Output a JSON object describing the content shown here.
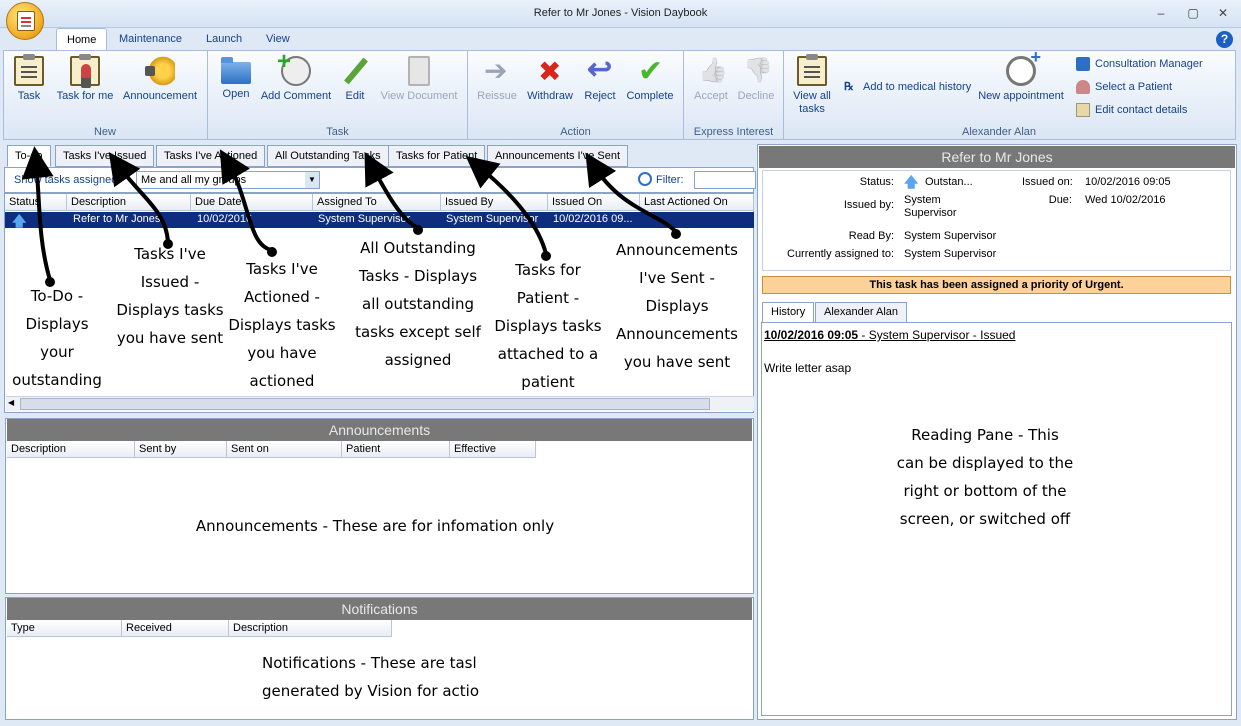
{
  "window": {
    "title": "Refer to Mr Jones - Vision Daybook",
    "controls": [
      "–",
      "▢",
      "✕"
    ]
  },
  "ribbon_tabs": [
    "Home",
    "Maintenance",
    "Launch",
    "View"
  ],
  "ribbon": {
    "new": {
      "title": "New",
      "buttons": [
        "Task",
        "Task for me",
        "Announcement"
      ]
    },
    "task": {
      "title": "Task",
      "buttons": [
        "Open",
        "Add Comment",
        "Edit",
        "View Document"
      ]
    },
    "action": {
      "title": "Action",
      "buttons": [
        "Reissue",
        "Withdraw",
        "Reject",
        "Complete"
      ]
    },
    "express": {
      "title": "Express Interest",
      "buttons": [
        "Accept",
        "Decline"
      ]
    },
    "user": {
      "title": "Alexander Alan",
      "view_all": "View all tasks",
      "add_history": "Add to medical history",
      "new_appointment": "New appointment",
      "consultation_manager": "Consultation Manager",
      "select_patient": "Select a Patient",
      "edit_contact": "Edit contact details"
    }
  },
  "daybook_tabs": [
    "To-do",
    "Tasks I've Issued",
    "Tasks I've Actioned",
    "All Outstanding Tasks",
    "Tasks for Patient",
    "Announcements I've Sent"
  ],
  "filter": {
    "show_label": "Show tasks assigned",
    "show_value": "Me and all my groups",
    "filter_label": "Filter:"
  },
  "task_columns": [
    "Status",
    "Description",
    "Due Date",
    "Assigned To",
    "Issued By",
    "Issued On",
    "Last Actioned On"
  ],
  "task_rows": [
    {
      "description": "Refer to Mr Jones",
      "due": "10/02/2016",
      "assigned": "System Supervisor",
      "issued_by": "System Supervisor",
      "issued_on": "10/02/2016 09..."
    }
  ],
  "announcements": {
    "title": "Announcements",
    "columns": [
      "Description",
      "Sent by",
      "Sent on",
      "Patient",
      "Effective"
    ]
  },
  "notifications": {
    "title": "Notifications",
    "columns": [
      "Type",
      "Received",
      "Description"
    ]
  },
  "reading_pane": {
    "title": "Refer to Mr Jones",
    "status_label": "Status:",
    "status_value": "Outstan...",
    "issued_on_label": "Issued on:",
    "issued_on_value": "10/02/2016 09:05",
    "issued_by_label": "Issued by:",
    "issued_by_value_1": "System",
    "issued_by_value_2": "Supervisor",
    "due_label": "Due:",
    "due_value": "Wed 10/02/2016",
    "read_by_label": "Read By:",
    "read_by_value": "System Supervisor",
    "assigned_label": "Currently assigned to:",
    "assigned_value": "System Supervisor",
    "priority_banner": "This task has been assigned a priority of Urgent.",
    "history_tabs": [
      "History",
      "Alexander Alan"
    ],
    "history_entry_date": "10/02/2016 09:05",
    "history_entry_rest": " - System Supervisor - Issued",
    "history_text": "Write letter asap"
  },
  "annotations": {
    "todo": [
      "To-Do -",
      "Displays",
      "your",
      "outstanding"
    ],
    "issued": [
      "Tasks I've",
      "Issued -",
      "Displays tasks",
      "you have sent"
    ],
    "actioned": [
      "Tasks I've",
      "Actioned -",
      "Displays tasks",
      "you have",
      "actioned"
    ],
    "outstanding": [
      "All Outstanding",
      "Tasks - Displays",
      "all outstanding",
      "tasks except self",
      "assigned"
    ],
    "patient": [
      "Tasks for",
      "Patient -",
      "Displays tasks",
      "attached to a",
      "patient"
    ],
    "sent": [
      "Announcements",
      "I've Sent -",
      "Displays",
      "Announcements",
      "you have sent"
    ],
    "announcements": "Announcements - These are for infomation only",
    "notifications": [
      "Notifications - These are tasl",
      "generated by Vision for actio"
    ],
    "reading": [
      "Reading Pane - This",
      "can be displayed to the",
      "right or bottom of the",
      "screen, or switched off"
    ]
  }
}
